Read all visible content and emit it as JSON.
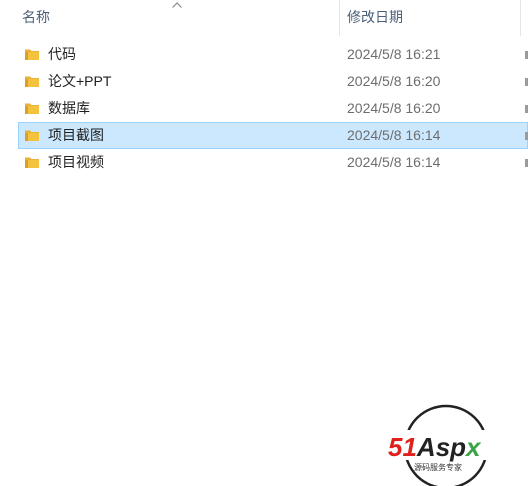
{
  "header": {
    "name_label": "名称",
    "date_label": "修改日期",
    "sort_indicator": "up-chevron-icon"
  },
  "rows": [
    {
      "name": "代码",
      "modified": "2024/5/8 16:21",
      "icon": "folder-icon",
      "selected": false
    },
    {
      "name": "论文+PPT",
      "modified": "2024/5/8 16:20",
      "icon": "folder-icon",
      "selected": false
    },
    {
      "name": "数据库",
      "modified": "2024/5/8 16:20",
      "icon": "folder-icon",
      "selected": false
    },
    {
      "name": "项目截图",
      "modified": "2024/5/8 16:14",
      "icon": "folder-icon",
      "selected": true
    },
    {
      "name": "项目视频",
      "modified": "2024/5/8 16:14",
      "icon": "folder-icon",
      "selected": false
    }
  ],
  "watermark": {
    "logo_text": "51Aspx",
    "tagline": "源码服务专家"
  },
  "colors": {
    "selection_bg": "#cce8ff",
    "selection_border": "#99d1ff",
    "folder": "#f3c33e",
    "logo_red": "#e0211b",
    "logo_green": "#3aa547"
  }
}
